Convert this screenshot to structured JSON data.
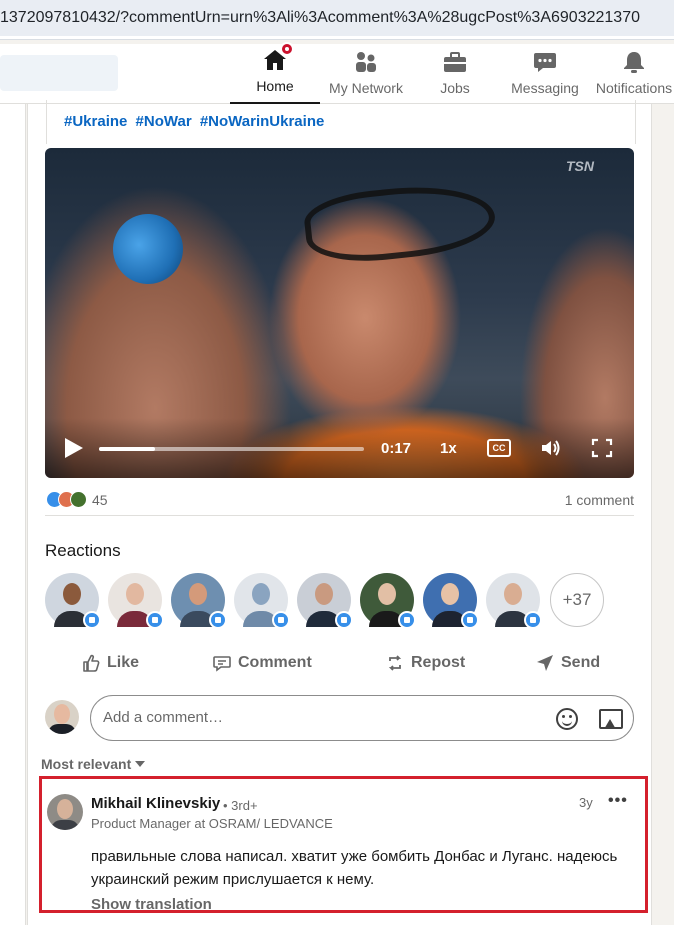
{
  "browser": {
    "url": "1372097810432/?commentUrn=urn%3Ali%3Acomment%3A%28ugcPost%3A6903221370"
  },
  "nav": {
    "home": "Home",
    "network": "My Network",
    "jobs": "Jobs",
    "messaging": "Messaging",
    "notifications": "Notifications"
  },
  "post": {
    "hashtags": [
      "#Ukraine",
      "#NoWar",
      "#NoWarinUkraine"
    ],
    "video": {
      "watermark": "TSN",
      "time": "0:17",
      "speed": "1x",
      "cc": "CC",
      "progress": 0.21
    },
    "reaction_count": "45",
    "comment_count": "1 comment"
  },
  "reactions": {
    "title": "Reactions",
    "more": "+37",
    "avatars": [
      {
        "bg": "#cfd6df",
        "skin": "#8b5a3c",
        "shirt": "#2b2f36"
      },
      {
        "bg": "#e9e4e0",
        "skin": "#e2b8a0",
        "shirt": "#7a2a3a"
      },
      {
        "bg": "#6e8fb0",
        "skin": "#d49a7a",
        "shirt": "#3a4a5e"
      },
      {
        "bg": "#e1e5ea",
        "skin": "#8aa4c0",
        "shirt": "#6f8aa8"
      },
      {
        "bg": "#c9ced6",
        "skin": "#c99a80",
        "shirt": "#1f2a3a"
      },
      {
        "bg": "#3f5a3a",
        "skin": "#e2bfa5",
        "shirt": "#1a1a1a"
      },
      {
        "bg": "#3f6fb0",
        "skin": "#e7c2a6",
        "shirt": "#1d2330"
      },
      {
        "bg": "#dfe3e8",
        "skin": "#d9ad92",
        "shirt": "#2c3440"
      }
    ]
  },
  "actions": {
    "like": "Like",
    "comment": "Comment",
    "repost": "Repost",
    "send": "Send"
  },
  "composer": {
    "placeholder": "Add a comment…"
  },
  "sort": {
    "label": "Most relevant"
  },
  "comment": {
    "author": "Mikhail Klinevskiy",
    "degree": "• 3rd+",
    "headline": "Product Manager at OSRAM/ LEDVANCE",
    "time": "3y",
    "more": "•••",
    "text": "правильные слова написал. хватит уже бомбить Донбас и Луганс. надеюсь украинский режим прислушается к нему.",
    "translate": "Show translation"
  },
  "colors": {
    "brand_blue": "#0a66c2",
    "highlight_red": "#d4202d",
    "notification_red": "#cb112d"
  }
}
